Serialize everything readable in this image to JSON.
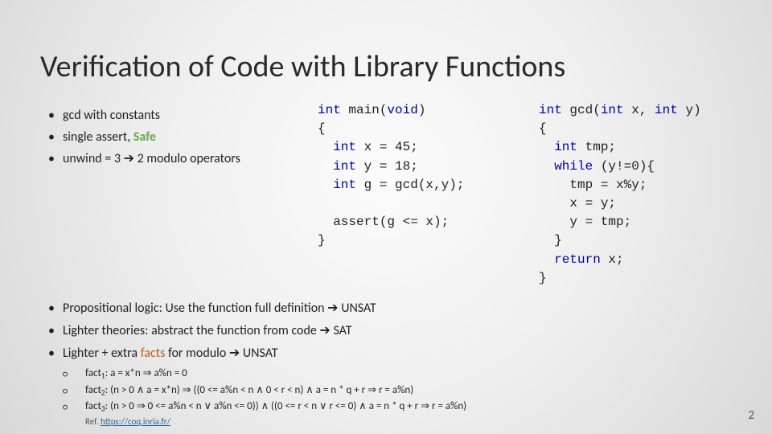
{
  "title": "Verification of Code with Library Functions",
  "top_bullets": {
    "b1": "gcd with constants",
    "b2_pre": "single assert",
    "b2_safe": "Safe",
    "b3_pre": "unwind = 3 ",
    "b3_post": " 2 modulo operators"
  },
  "code_main": {
    "l1a": "int",
    "l1b": " main(",
    "l1c": "void",
    "l1d": ")",
    "l2": "{",
    "l3a": "  int",
    "l3b": " x = 45;",
    "l4a": "  int",
    "l4b": " y = 18;",
    "l5a": "  int",
    "l5b": " g = gcd(x,y);",
    "blank": "",
    "l6": "  assert(g <= x);",
    "l7": "}"
  },
  "code_gcd": {
    "l1a": "int",
    "l1b": " gcd(",
    "l1c": "int",
    "l1d": " x, ",
    "l1e": "int",
    "l1f": " y)",
    "l2": "{",
    "l3a": "  int",
    "l3b": " tmp;",
    "l4a": "  while",
    "l4b": " (y!=0){",
    "l5": "    tmp = x%y;",
    "l6": "    x = y;",
    "l7": "    y = tmp;",
    "l8": "  }",
    "l9a": "  return",
    "l9b": " x;",
    "l10": "}"
  },
  "bottom_bullets": {
    "b1_pre": "Propositional logic: Use the function full definition ",
    "b1_post": " UNSAT",
    "b2_pre": "Lighter theories: abstract the function from code ",
    "b2_post": " SAT",
    "b3_pre": "Lighter + extra ",
    "b3_mid": "facts",
    "b3_post1": " for modulo ",
    "b3_post2": " UNSAT"
  },
  "facts": {
    "f1_label": "fact",
    "f1_sub": "1",
    "f1_body": ": a = x*n ⇒ a%n = 0",
    "f2_label": "fact",
    "f2_sub": "2",
    "f2_body": ": (n > 0 ∧ a = x*n) ⇒ ((0 <= a%n < n  ∧ 0 < r < n)  ∧ a = n * q + r ⇒ r = a%n)",
    "f3_label": "fact",
    "f3_sub": "3",
    "f3_body": ": (n > 0 ⇒ 0 <= a%n < n ∨ a%n <= 0)) ∧ ((0 <= r < n ∨ r <= 0)  ∧ a = n * q + r ⇒ r = a%n)"
  },
  "ref_label": "Ref. ",
  "ref_url": "https://coq.inria.fr/",
  "page_number": "2",
  "arrow": "➔"
}
